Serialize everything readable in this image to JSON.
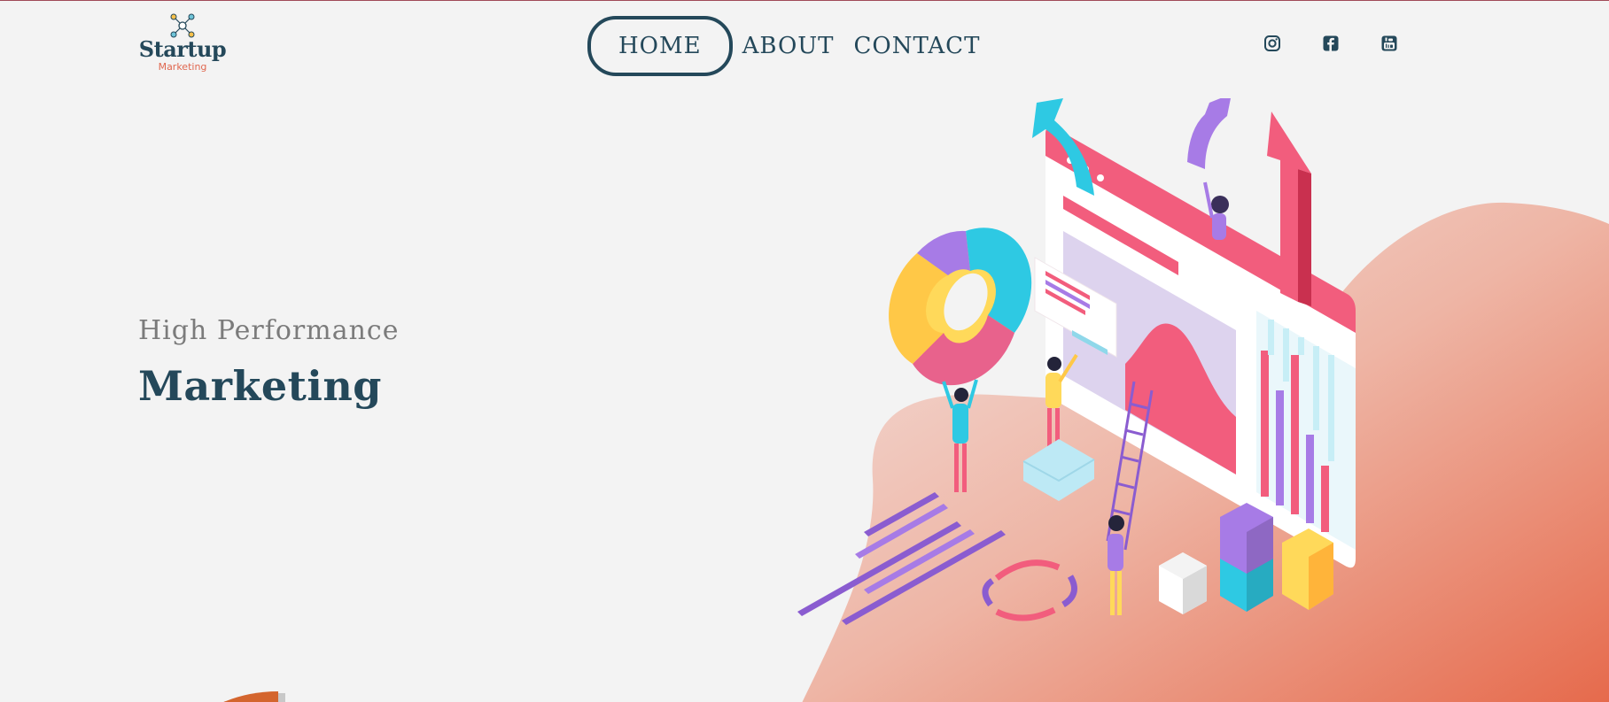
{
  "logo": {
    "title": "Startup",
    "subtitle": "Marketing",
    "icon": "network-nodes-icon"
  },
  "nav": {
    "items": [
      {
        "label": "HOME",
        "active": true
      },
      {
        "label": "ABOUT",
        "active": false
      },
      {
        "label": "CONTACT",
        "active": false
      }
    ]
  },
  "social": {
    "icons": [
      "instagram-icon",
      "facebook-icon",
      "youtube-icon"
    ]
  },
  "hero": {
    "kicker": "High Performance",
    "title": "Marketing"
  },
  "colors": {
    "primary": "#24485a",
    "accent": "#e0674f",
    "background": "#f3f3f3",
    "pink": "#f25d7d",
    "purple": "#a77be6",
    "cyan": "#2ec9e3",
    "yellow": "#ffd95a"
  }
}
